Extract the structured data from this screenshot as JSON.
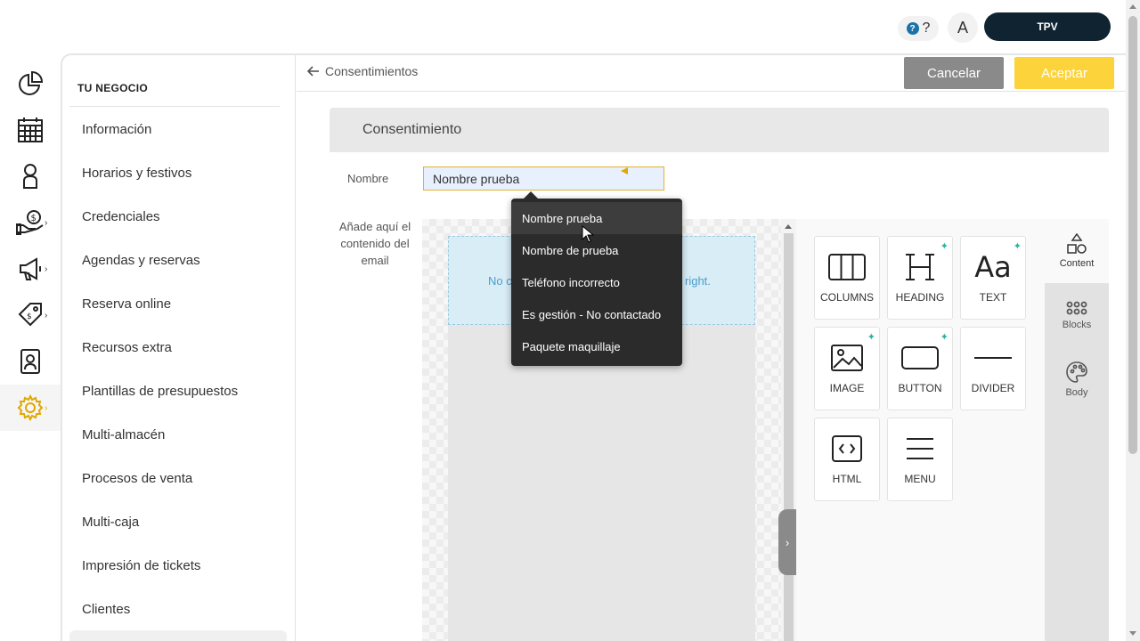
{
  "topbar": {
    "help_label": "?",
    "avatar_initial": "A",
    "tpv_label": "TPV"
  },
  "rail": {
    "items": [
      "dashboard-pie-icon",
      "calendar-grid-icon",
      "person-icon",
      "money-hand-icon",
      "megaphone-icon",
      "tags-icon",
      "contact-card-icon",
      "settings-gear-icon"
    ],
    "active": "settings-gear-icon",
    "accent": "#e0a800"
  },
  "nav": {
    "heading": "TU NEGOCIO",
    "items": [
      {
        "label": "Información"
      },
      {
        "label": "Horarios y festivos"
      },
      {
        "label": "Credenciales"
      },
      {
        "label": "Agendas y reservas"
      },
      {
        "label": "Reserva online"
      },
      {
        "label": "Recursos extra"
      },
      {
        "label": "Plantillas de presupuestos"
      },
      {
        "label": "Multi-almacén"
      },
      {
        "label": "Procesos de venta"
      },
      {
        "label": "Multi-caja"
      },
      {
        "label": "Impresión de tickets"
      },
      {
        "label": "Clientes"
      }
    ]
  },
  "header": {
    "back_label": "Consentimientos",
    "cancel_label": "Cancelar",
    "accept_label": "Aceptar",
    "accept_color": "#fcd33b",
    "cancel_color": "#8a8a8a"
  },
  "form": {
    "section_title": "Consentimiento",
    "name_label": "Nombre",
    "name_value": "Nombre prueba",
    "content_label": "Añade aquí el contenido del email"
  },
  "editor": {
    "dropzone_text_left": "No c",
    "dropzone_text_right": "right.",
    "tools": [
      {
        "label": "COLUMNS",
        "icon": "columns-icon",
        "new": false
      },
      {
        "label": "HEADING",
        "icon": "heading-icon",
        "new": true
      },
      {
        "label": "TEXT",
        "icon": "text-icon",
        "new": true
      },
      {
        "label": "IMAGE",
        "icon": "image-icon",
        "new": true
      },
      {
        "label": "BUTTON",
        "icon": "button-icon",
        "new": true
      },
      {
        "label": "DIVIDER",
        "icon": "divider-icon",
        "new": false
      },
      {
        "label": "HTML",
        "icon": "html-icon",
        "new": false
      },
      {
        "label": "MENU",
        "icon": "menu-icon",
        "new": false
      }
    ],
    "tabs": [
      {
        "label": "Content",
        "icon": "shapes-icon"
      },
      {
        "label": "Blocks",
        "icon": "blocks-grid-icon"
      },
      {
        "label": "Body",
        "icon": "palette-icon"
      }
    ],
    "sparkle_color": "#2bb3a3"
  },
  "autocomplete": {
    "options": [
      "Nombre prueba",
      "Nombre de prueba",
      "Teléfono incorrecto",
      "Es gestión - No contactado",
      "Paquete maquillaje"
    ],
    "hovered": "Nombre prueba"
  }
}
